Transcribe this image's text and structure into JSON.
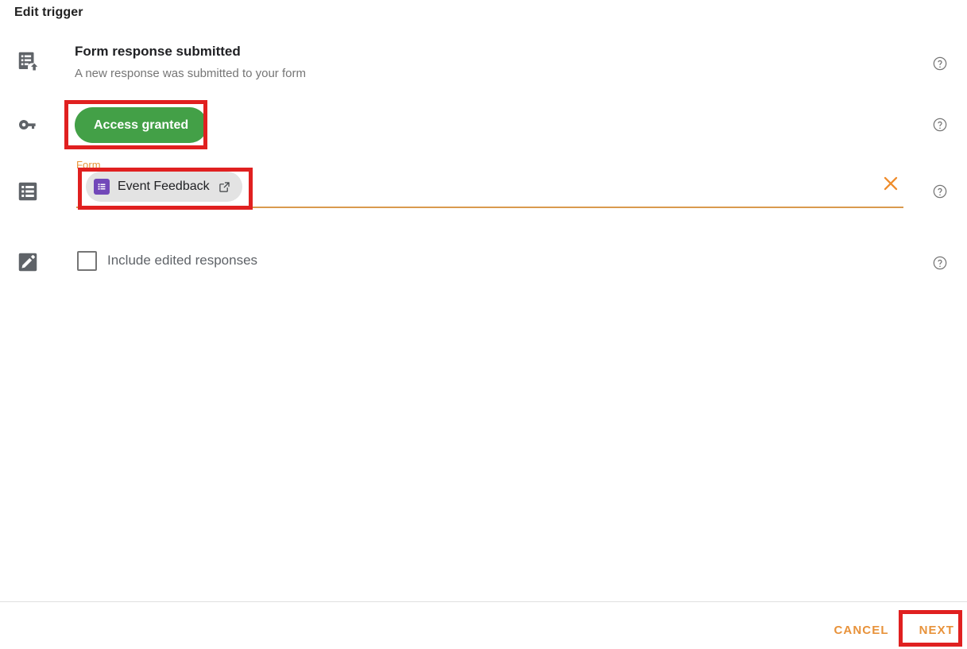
{
  "dialog": {
    "title": "Edit trigger"
  },
  "rows": {
    "trigger": {
      "icon": "form-upload-icon",
      "title": "Form response submitted",
      "subtitle": "A new response was submitted to your form",
      "help": "help-icon"
    },
    "access": {
      "icon": "key-icon",
      "button_label": "Access granted",
      "help": "help-icon"
    },
    "form": {
      "icon": "list-icon",
      "field_label": "Form",
      "chip_icon": "google-forms-icon",
      "chip_label": "Event Feedback",
      "chip_open_icon": "external-link-icon",
      "clear_icon": "close-x-icon",
      "help": "help-icon"
    },
    "edited": {
      "icon": "pencil-icon",
      "checkbox_checked": false,
      "checkbox_label": "Include edited responses",
      "help": "help-icon"
    }
  },
  "footer": {
    "cancel_label": "CANCEL",
    "next_label": "NEXT"
  },
  "colors": {
    "accent_orange": "#e8923a",
    "green_pill": "#43a047",
    "forms_purple": "#7248b9",
    "annotation_red": "#e02020",
    "chip_gray": "#e3e3e3"
  }
}
